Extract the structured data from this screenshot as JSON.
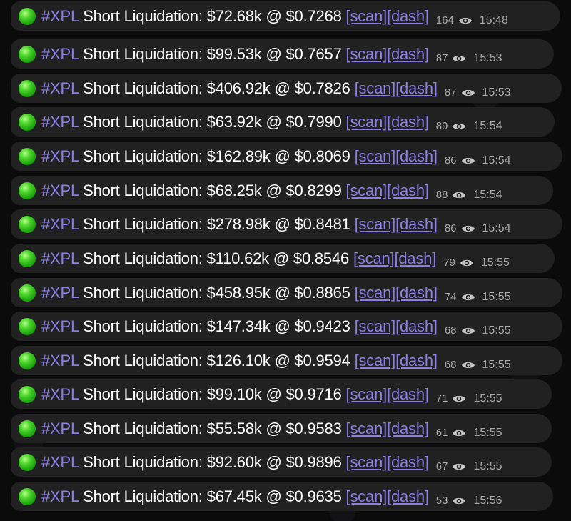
{
  "messages": [
    {
      "tag": "#XPL",
      "text": " Short Liquidation: $72.68k @ $0.7268 ",
      "scan": "[scan]",
      "dash": "[dash]",
      "views": "164",
      "time": "15:48"
    },
    {
      "tag": "#XPL",
      "text": " Short Liquidation: $99.53k @ $0.7657 ",
      "scan": "[scan]",
      "dash": "[dash]",
      "views": "87",
      "time": "15:53"
    },
    {
      "tag": "#XPL",
      "text": " Short Liquidation: $406.92k @ $0.7826 ",
      "scan": "[scan]",
      "dash": "[dash]",
      "views": "87",
      "time": "15:53"
    },
    {
      "tag": "#XPL",
      "text": " Short Liquidation: $63.92k @ $0.7990 ",
      "scan": "[scan]",
      "dash": "[dash]",
      "views": "89",
      "time": "15:54"
    },
    {
      "tag": "#XPL",
      "text": " Short Liquidation: $162.89k @ $0.8069 ",
      "scan": "[scan]",
      "dash": "[dash]",
      "views": "86",
      "time": "15:54"
    },
    {
      "tag": "#XPL",
      "text": " Short Liquidation: $68.25k @ $0.8299 ",
      "scan": "[scan]",
      "dash": "[dash]",
      "views": "88",
      "time": "15:54"
    },
    {
      "tag": "#XPL",
      "text": " Short Liquidation: $278.98k @ $0.8481 ",
      "scan": "[scan]",
      "dash": "[dash]",
      "views": "86",
      "time": "15:54"
    },
    {
      "tag": "#XPL",
      "text": " Short Liquidation: $110.62k @ $0.8546 ",
      "scan": "[scan]",
      "dash": "[dash]",
      "views": "79",
      "time": "15:55"
    },
    {
      "tag": "#XPL",
      "text": " Short Liquidation: $458.95k @ $0.8865 ",
      "scan": "[scan]",
      "dash": "[dash]",
      "views": "74",
      "time": "15:55"
    },
    {
      "tag": "#XPL",
      "text": " Short Liquidation: $147.34k @ $0.9423 ",
      "scan": "[scan]",
      "dash": "[dash]",
      "views": "68",
      "time": "15:55"
    },
    {
      "tag": "#XPL",
      "text": " Short Liquidation: $126.10k @ $0.9594 ",
      "scan": "[scan]",
      "dash": "[dash]",
      "views": "68",
      "time": "15:55"
    },
    {
      "tag": "#XPL",
      "text": " Short Liquidation: $99.10k @ $0.9716 ",
      "scan": "[scan]",
      "dash": "[dash]",
      "views": "71",
      "time": "15:55"
    },
    {
      "tag": "#XPL",
      "text": " Short Liquidation: $55.58k @ $0.9583 ",
      "scan": "[scan]",
      "dash": "[dash]",
      "views": "61",
      "time": "15:55"
    },
    {
      "tag": "#XPL",
      "text": " Short Liquidation: $92.60k @ $0.9896 ",
      "scan": "[scan]",
      "dash": "[dash]",
      "views": "67",
      "time": "15:55"
    },
    {
      "tag": "#XPL",
      "text": " Short Liquidation: $67.45k @ $0.9635 ",
      "scan": "[scan]",
      "dash": "[dash]",
      "views": "53",
      "time": "15:56"
    }
  ],
  "icons": {
    "status": "green-circle-icon",
    "views": "eye-icon"
  },
  "colors": {
    "background": "#0b0b0c",
    "bubble": "#212121",
    "accent_link": "#8b7ee6",
    "text": "#ffffff",
    "meta": "#a8a8a8",
    "status_dot": "#1fa80f"
  }
}
